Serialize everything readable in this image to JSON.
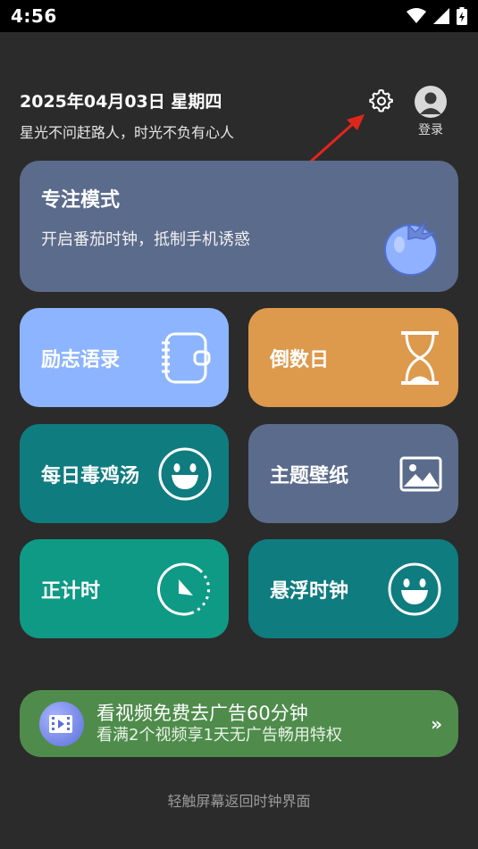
{
  "status_bar": {
    "time": "4:56",
    "icons": [
      "wifi-icon",
      "signal-icon",
      "battery-charging-icon"
    ]
  },
  "header": {
    "date": "2025年04月03日 星期四",
    "motto": "星光不问赶路人，时光不负有心人",
    "settings_icon": "gear-icon",
    "login_label": "登录"
  },
  "focus": {
    "title": "专注模式",
    "subtitle": "开启番茄时钟，抵制手机诱惑",
    "icon": "tomato-icon",
    "color": "#5b6b8b"
  },
  "tiles": [
    {
      "title": "励志语录",
      "icon": "notebook-icon",
      "color": "#8cb4ff"
    },
    {
      "title": "倒数日",
      "icon": "hourglass-icon",
      "color": "#dd994c"
    },
    {
      "title": "每日毒鸡汤",
      "icon": "smiley-icon",
      "color": "#0f7c80"
    },
    {
      "title": "主题壁纸",
      "icon": "image-icon",
      "color": "#5b6b8b"
    },
    {
      "title": "正计时",
      "icon": "stopwatch-icon",
      "color": "#0f9a86"
    },
    {
      "title": "悬浮时钟",
      "icon": "smiley-icon",
      "color": "#0f7c80"
    }
  ],
  "promo": {
    "title": "看视频免费去广告60分钟",
    "subtitle": "看满2个视频享1天无广告畅用特权",
    "icon": "video-icon",
    "chevron": "»",
    "color": "#4f8c4c"
  },
  "footer": {
    "hint": "轻触屏幕返回时钟界面"
  }
}
